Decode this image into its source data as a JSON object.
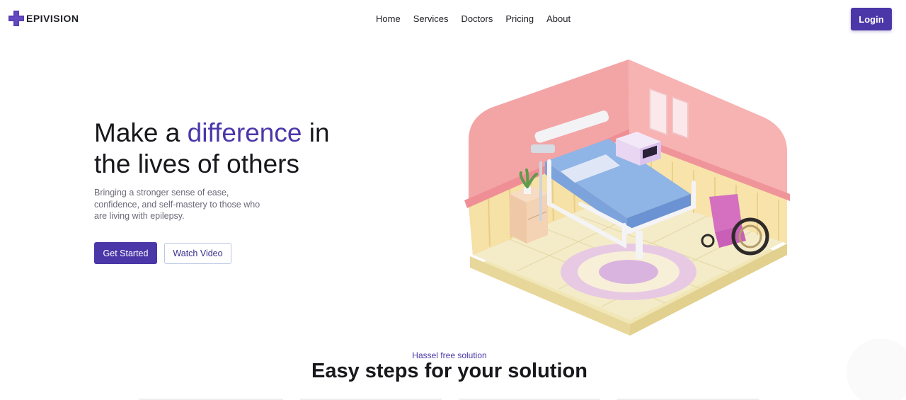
{
  "brand": {
    "name": "EPIVISION",
    "accent_color": "#4b37a8"
  },
  "nav": {
    "items": [
      "Home",
      "Services",
      "Doctors",
      "Pricing",
      "About"
    ]
  },
  "header": {
    "login_label": "Login"
  },
  "hero": {
    "title_part1": "Make a ",
    "title_accent": "difference",
    "title_part2": " in the lives of others",
    "subtitle": "Bringing a stronger sense of ease, confidence, and self-mastery to those who are living with epilepsy.",
    "primary_button": "Get Started",
    "secondary_button": "Watch Video"
  },
  "section": {
    "eyebrow": "Hassel free solution",
    "title": "Easy steps for your solution"
  }
}
